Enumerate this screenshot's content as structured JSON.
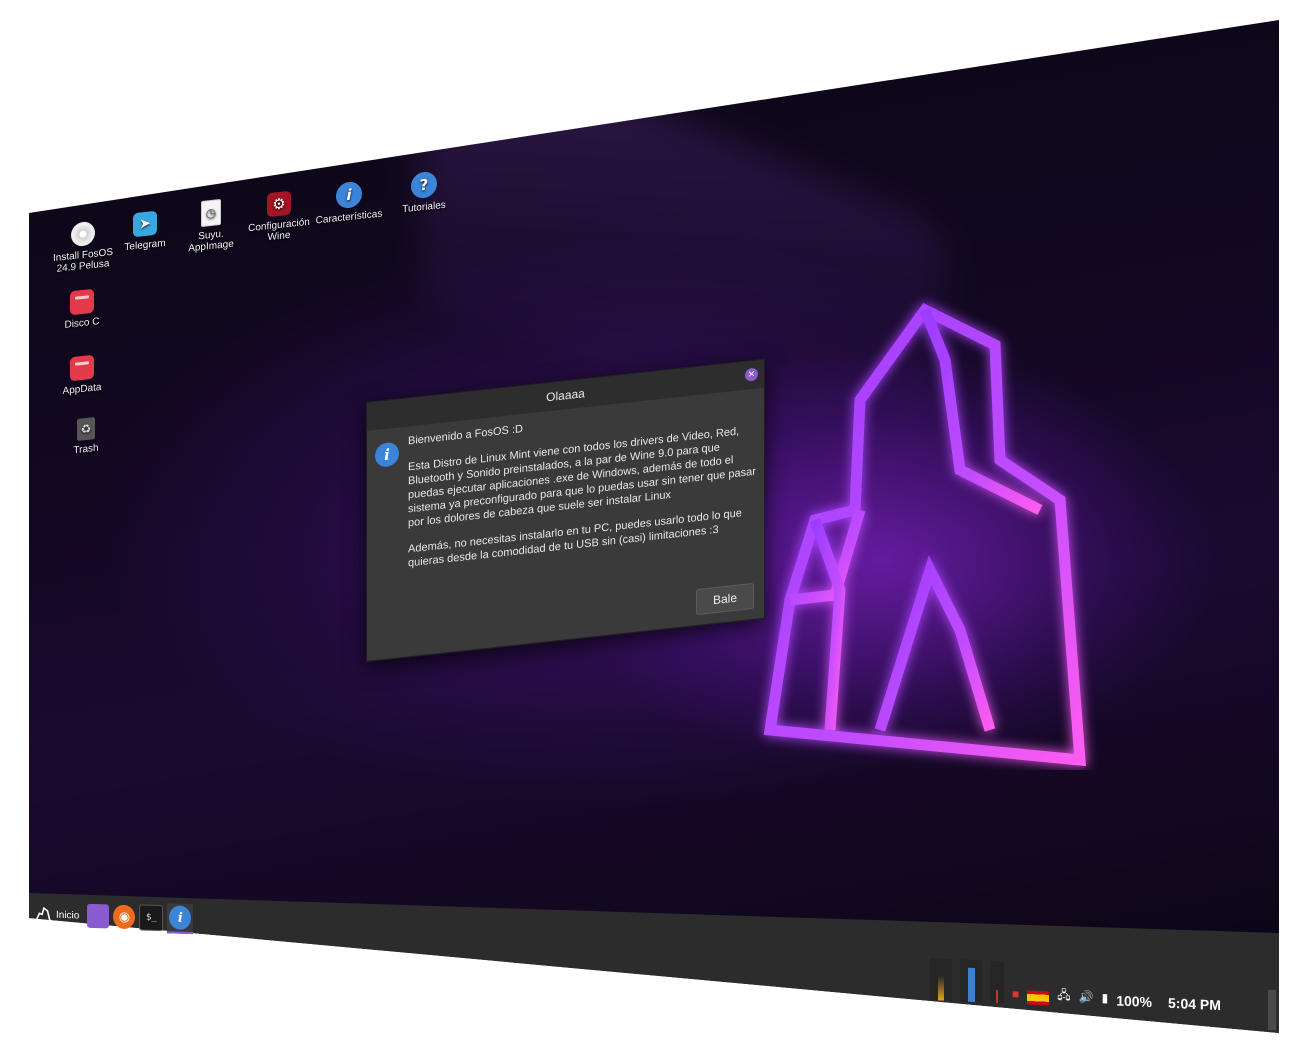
{
  "desktop": {
    "icons": [
      {
        "label": "Install FosOS\n24.9 Pelusa",
        "icon": "disc-icon"
      },
      {
        "label": "Telegram",
        "icon": "telegram-icon"
      },
      {
        "label": "Suyu.\nAppImage",
        "icon": "appimage-icon"
      },
      {
        "label": "Configuración\nWine",
        "icon": "wine-config-icon"
      },
      {
        "label": "Características",
        "icon": "info-icon"
      },
      {
        "label": "Tutoriales",
        "icon": "help-icon"
      },
      {
        "label": "Disco C",
        "icon": "folder-icon"
      },
      {
        "label": "AppData",
        "icon": "folder-icon"
      },
      {
        "label": "Trash",
        "icon": "trash-icon"
      }
    ]
  },
  "dialog": {
    "title": "Olaaaa",
    "greeting": "Bienvenido a FosOS :D",
    "paragraph1": "Esta Distro de Linux Mint viene con todos los drivers de Video, Red, Bluetooth y Sonido preinstalados, a la par de Wine 9.0 para que puedas ejecutar aplicaciones .exe de Windows, además de todo el sistema ya preconfigurado para que lo puedas usar sin tener que pasar por los dolores de cabeza que suele ser instalar Linux",
    "paragraph2": "Además, no necesitas instalarlo en tu PC, puedes usarlo todo lo que quieras desde la comodidad de tu USB sin (casi) limitaciones :3",
    "button_label": "Bale"
  },
  "taskbar": {
    "start_label": "Inicio",
    "apps": [
      "files-icon",
      "firefox-icon",
      "terminal-icon",
      "info-icon"
    ],
    "terminal_glyph": "$_",
    "battery": "100%",
    "clock": "5:04 PM"
  },
  "colors": {
    "accent": "#8a5ad0",
    "logo_glow": "#c14cff",
    "taskbar": "#2c2c2c",
    "dialog_bg": "#3a3a3a"
  }
}
